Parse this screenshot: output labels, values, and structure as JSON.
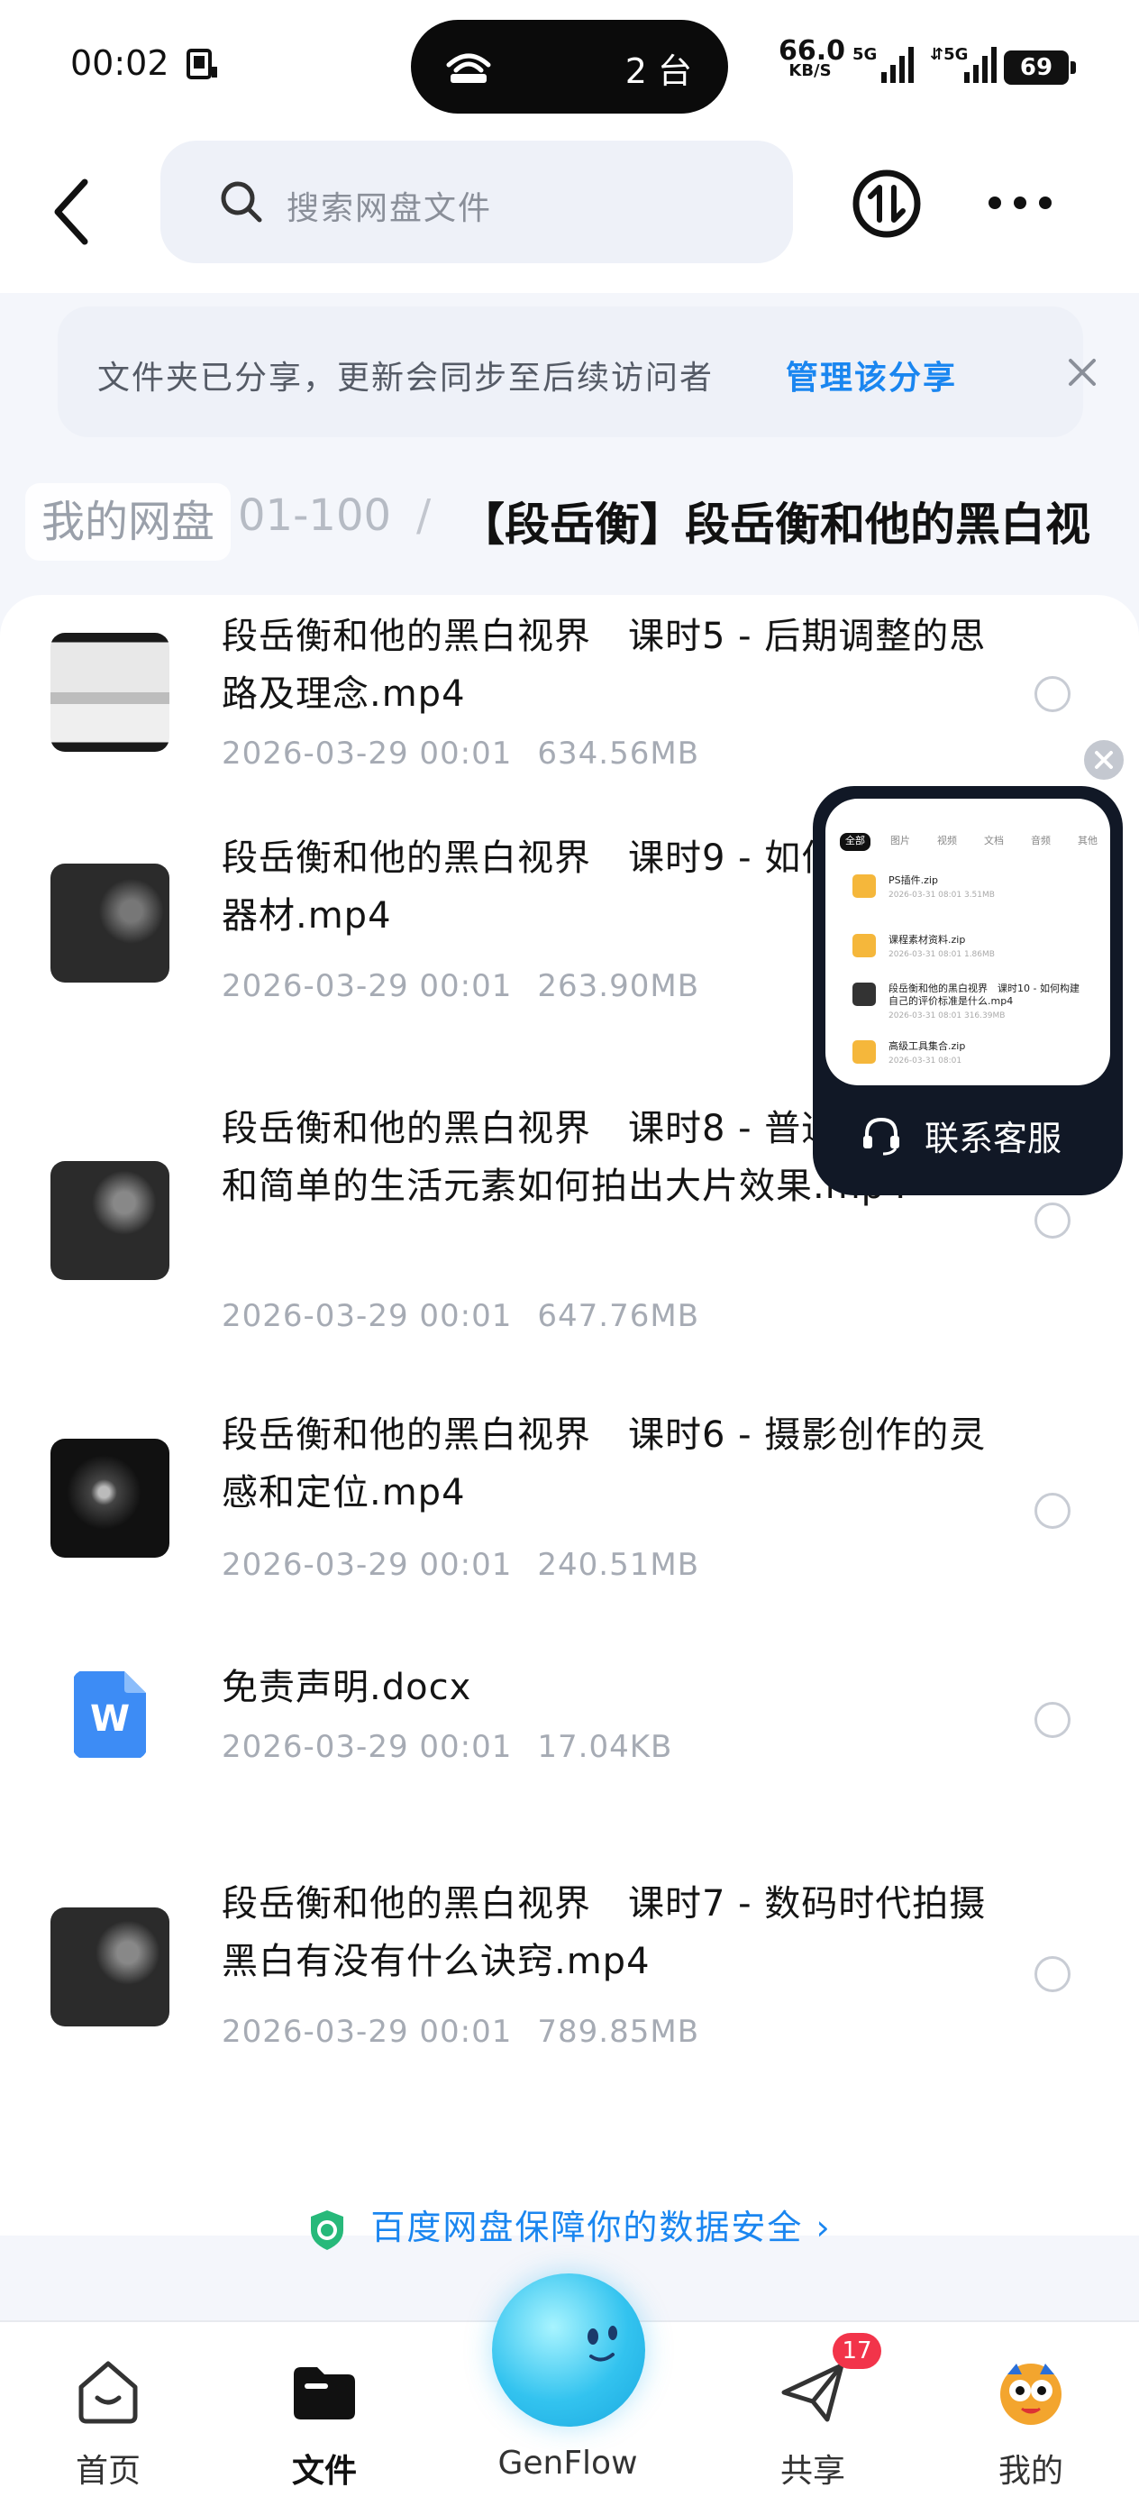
{
  "status_bar": {
    "time": "00:02",
    "pill_text": "2 台",
    "net_speed": "66.0",
    "net_unit": "KB/S",
    "sig1_label": "5G",
    "sig2_label": "5G",
    "battery": "69"
  },
  "header": {
    "search_placeholder": "搜索网盘文件"
  },
  "notice": {
    "text": "文件夹已分享，更新会同步至后续访问者",
    "link": "管理该分享"
  },
  "breadcrumb": {
    "home": "我的网盘",
    "middle": "01-100",
    "separator": "/",
    "current": "【段岳衡】段岳衡和他的黑白视"
  },
  "files": [
    {
      "name": "段岳衡和他的黑白视界　课时5 - 后期调整的思路及理念.mp4",
      "date": "2026-03-29 00:01",
      "size": "634.56MB"
    },
    {
      "name": "段岳衡和他的黑白视界　课时9 - 如何选择摄影器材.mp4",
      "date": "2026-03-29 00:01",
      "size": "263.90MB"
    },
    {
      "name": "段岳衡和他的黑白视界　课时8 - 普通摄影器材和简单的生活元素如何拍出大片效果.mp4",
      "date": "2026-03-29 00:01",
      "size": "647.76MB"
    },
    {
      "name": "段岳衡和他的黑白视界　课时6 - 摄影创作的灵感和定位.mp4",
      "date": "2026-03-29 00:01",
      "size": "240.51MB"
    },
    {
      "name": "免责声明.docx",
      "date": "2026-03-29 00:01",
      "size": "17.04KB"
    },
    {
      "name": "段岳衡和他的黑白视界　课时7 - 数码时代拍摄黑白有没有什么诀窍.mp4",
      "date": "2026-03-29 00:01",
      "size": "789.85MB"
    }
  ],
  "safety": {
    "text": "百度网盘保障你的数据安全"
  },
  "float_widget": {
    "label": "联系客服",
    "mini_tabs": [
      "全部",
      "图片",
      "视频",
      "文档",
      "音频",
      "其他"
    ],
    "mini_rows": [
      {
        "title": "PS插件.zip",
        "sub": "2026-03-31 08:01 3.51MB"
      },
      {
        "title": "课程素材资料.zip",
        "sub": "2026-03-31 08:01 1.86MB"
      },
      {
        "title": "段岳衡和他的黑白视界　课时10 - 如何构建自己的评价标准是什么.mp4",
        "sub": "2026-03-31 08:01 316.39MB"
      },
      {
        "title": "高级工具集合.zip",
        "sub": "2026-03-31 08:01"
      }
    ]
  },
  "bottom_nav": {
    "items": [
      "首页",
      "文件",
      "GenFlow",
      "共享",
      "我的"
    ],
    "share_badge": "17"
  },
  "colors": {
    "accent": "#1a86f0",
    "badge": "#f2344a",
    "genflow": "#33c3ef"
  }
}
